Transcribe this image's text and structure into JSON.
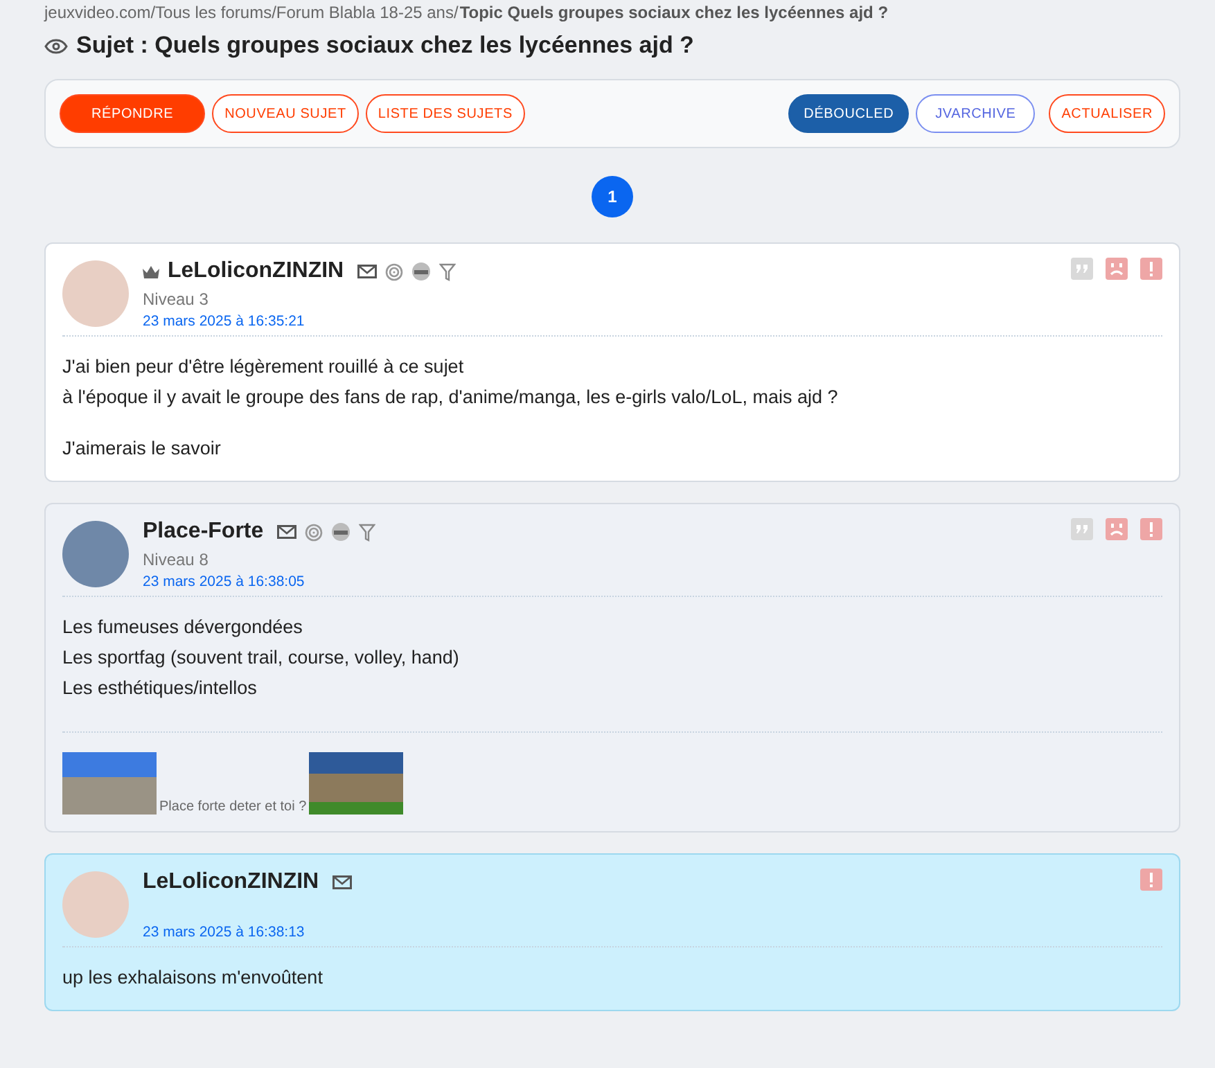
{
  "breadcrumb": {
    "path": "jeuxvideo.com/Tous les forums/Forum Blabla 18-25 ans/",
    "current": "Topic Quels groupes sociaux chez les lycéennes ajd ?"
  },
  "topic_title": "Sujet : Quels groupes sociaux chez les lycéennes ajd ?",
  "toolbar": {
    "left": [
      {
        "label": "RÉPONDRE",
        "kind": "primary"
      },
      {
        "label": "NOUVEAU SUJET",
        "kind": "outline"
      },
      {
        "label": "LISTE DES SUJETS",
        "kind": "outline"
      }
    ],
    "right": [
      {
        "label": "DÉBOUCLED",
        "kind": "dark"
      },
      {
        "label": "JVARCHIVE",
        "kind": "blue"
      },
      {
        "label": "ACTUALISER",
        "kind": "outline"
      }
    ]
  },
  "pages": [
    {
      "label": "1",
      "selected": true
    }
  ],
  "posts": [
    {
      "author": "LeLoliconZINZIN",
      "kind": "plain",
      "crown": true,
      "full_icons": true,
      "level": "Niveau 3",
      "date": "23 mars 2025 à 16:35:21",
      "full_actions": true,
      "paragraphs": [
        [
          "J'ai bien peur d'être légèrement rouillé à ce sujet",
          "à l'époque il y avait le groupe des fans de rap, d'anime/manga, les e-girls valo/LoL, mais ajd ?"
        ],
        [
          "J'aimerais le savoir"
        ]
      ]
    },
    {
      "author": "Place-Forte",
      "kind": "grey",
      "crown": false,
      "full_icons": true,
      "level": "Niveau 8",
      "date": "23 mars 2025 à 16:38:05",
      "full_actions": true,
      "paragraphs": [
        [
          "Les fumeuses dévergondées",
          "Les sportfag (souvent trail, course, volley, hand)",
          "Les esthétiques/intellos"
        ]
      ],
      "signature": "Place forte deter et toi ?"
    },
    {
      "author": "LeLoliconZINZIN",
      "kind": "highlight",
      "crown": false,
      "full_icons": false,
      "date": "23 mars 2025 à 16:38:13",
      "full_actions": false,
      "paragraphs": [
        [
          "up les exhalaisons m'envoûtent"
        ]
      ]
    }
  ]
}
